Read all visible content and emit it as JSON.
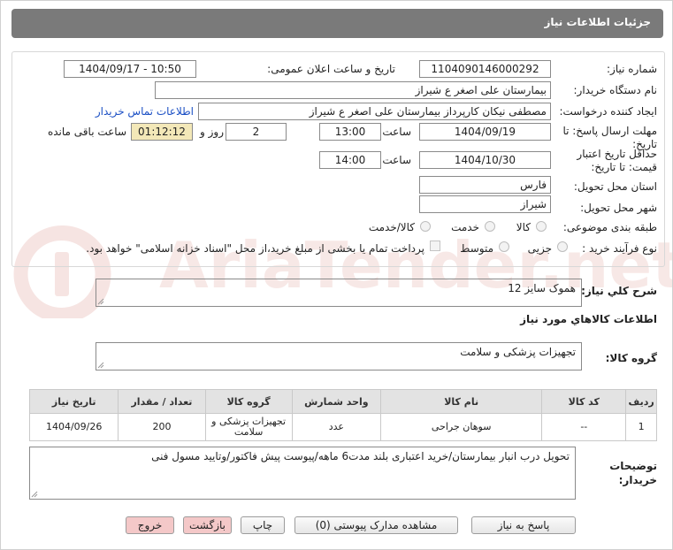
{
  "header": {
    "title": "جزئیات اطلاعات نیاز"
  },
  "form": {
    "need_number_label": "شماره نیاز:",
    "need_number": "1104090146000292",
    "announce_label": "تاریخ و ساعت اعلان عمومی:",
    "announce_value": "1404/09/17 - 10:50",
    "buyer_org_label": "نام دستگاه خریدار:",
    "buyer_org": "بیمارستان علی اصغر  ع  شیراز",
    "requester_label": "ایجاد کننده درخواست:",
    "requester": "مصطفی نیکان کارپرداز بیمارستان علی اصغر  ع  شیراز",
    "contact_link": "اطلاعات تماس خریدار",
    "deadline_label_1": "مهلت ارسال پاسخ: تا",
    "deadline_label_2": "تاریخ:",
    "deadline_date": "1404/09/19",
    "time_label": "ساعت",
    "deadline_time": "13:00",
    "days_value": "2",
    "days_label": "روز و",
    "remaining_time": "01:12:12",
    "remaining_label": "ساعت باقی مانده",
    "validity_label_1": "حداقل تاریخ اعتبار",
    "validity_label_2": "قیمت: تا تاریخ:",
    "validity_date": "1404/10/30",
    "validity_time": "14:00",
    "province_label": "استان محل تحویل:",
    "province": "فارس",
    "city_label": "شهر محل تحویل:",
    "city": "شیراز",
    "category_label": "طبقه بندی موضوعی:",
    "category_options": [
      "کالا",
      "خدمت",
      "کالا/خدمت"
    ],
    "process_label": "نوع فرآیند خرید :",
    "process_options": [
      "جزیی",
      "متوسط"
    ],
    "payment_note": "پرداخت تمام یا بخشی از مبلغ خرید،از محل \"اسناد خزانه اسلامی\" خواهد بود."
  },
  "summary": {
    "label": "شرح کلي نياز:",
    "value": "هموک سایز 12"
  },
  "goods_section": {
    "title": "اطلاعات کالاهاي مورد نياز"
  },
  "goods_group": {
    "label": "گروه کالا:",
    "value": "تجهیزات پزشکی و سلامت"
  },
  "table": {
    "headers": [
      "ردیف",
      "کد کالا",
      "نام کالا",
      "واحد شمارش",
      "گروه کالا",
      "تعداد / مقدار",
      "تاریخ نیاز"
    ],
    "rows": [
      {
        "row": "1",
        "code": "--",
        "name": "سوهان جراحی",
        "unit": "عدد",
        "group": "تجهیزات پزشکی و سلامت",
        "qty": "200",
        "date": "1404/09/26"
      }
    ]
  },
  "notes": {
    "label_1": "توضیحات",
    "label_2": "خریدار:",
    "value": "تحویل درب انبار بیمارستان/خرید اعتباری بلند مدت6 ماهه/پیوست پیش فاکتور/وتایید مسول فنی"
  },
  "buttons": {
    "respond": "پاسخ به نیاز",
    "docs": "مشاهده مدارک پیوستی (0)",
    "print": "چاپ",
    "back": "بازگشت",
    "exit": "خروج"
  },
  "watermark": "AriaTender.net",
  "colors": {
    "header_bg": "#7a7a7a",
    "remaining_bg": "#f3e8b8",
    "link": "#1b4fc4",
    "back_btn_bg": "#f4c8c8",
    "exit_btn_bg": "#f4c8c8"
  }
}
